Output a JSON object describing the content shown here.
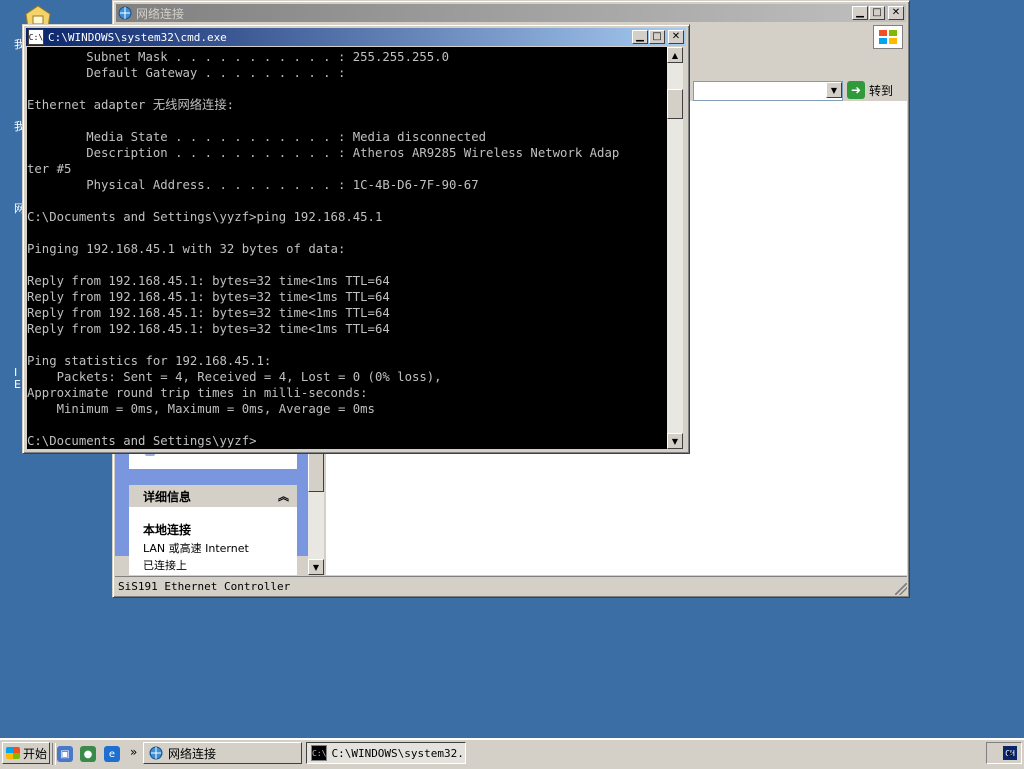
{
  "desktop": {
    "icon_labels": [
      "我",
      "我",
      "网",
      "I",
      "E"
    ]
  },
  "net_window": {
    "title": "网络连接",
    "go_label": "转到",
    "details_header": "详细信息",
    "details_name": "本地连接",
    "details_type": "LAN 或高速 Internet",
    "details_status": "已连接上",
    "status_text": "SiS191 Ethernet Controller"
  },
  "cmd_window": {
    "title": "C:\\WINDOWS\\system32\\cmd.exe",
    "icon_text": "C:\\",
    "lines": [
      "        Subnet Mask . . . . . . . . . . . : 255.255.255.0",
      "        Default Gateway . . . . . . . . . :",
      "",
      "Ethernet adapter 无线网络连接:",
      "",
      "        Media State . . . . . . . . . . . : Media disconnected",
      "        Description . . . . . . . . . . . : Atheros AR9285 Wireless Network Adap",
      "ter #5",
      "        Physical Address. . . . . . . . . : 1C-4B-D6-7F-90-67",
      "",
      "C:\\Documents and Settings\\yyzf>ping 192.168.45.1",
      "",
      "Pinging 192.168.45.1 with 32 bytes of data:",
      "",
      "Reply from 192.168.45.1: bytes=32 time<1ms TTL=64",
      "Reply from 192.168.45.1: bytes=32 time<1ms TTL=64",
      "Reply from 192.168.45.1: bytes=32 time<1ms TTL=64",
      "Reply from 192.168.45.1: bytes=32 time<1ms TTL=64",
      "",
      "Ping statistics for 192.168.45.1:",
      "    Packets: Sent = 4, Received = 4, Lost = 0 (0% loss),",
      "Approximate round trip times in milli-seconds:",
      "    Minimum = 0ms, Maximum = 0ms, Average = 0ms",
      "",
      "C:\\Documents and Settings\\yyzf>"
    ]
  },
  "taskbar": {
    "start_label": "开始",
    "chevron": "»",
    "tasks": [
      {
        "label": "网络连接",
        "icon": "network-icon"
      },
      {
        "label": "C:\\WINDOWS\\system32...",
        "icon": "cmd-icon"
      }
    ],
    "tray_ime": "CH",
    "tray_arrow": "«"
  },
  "colors": {
    "desktop": "#3a6ea5",
    "active_title": "#0a246a",
    "console_text": "#c0c0c0"
  }
}
